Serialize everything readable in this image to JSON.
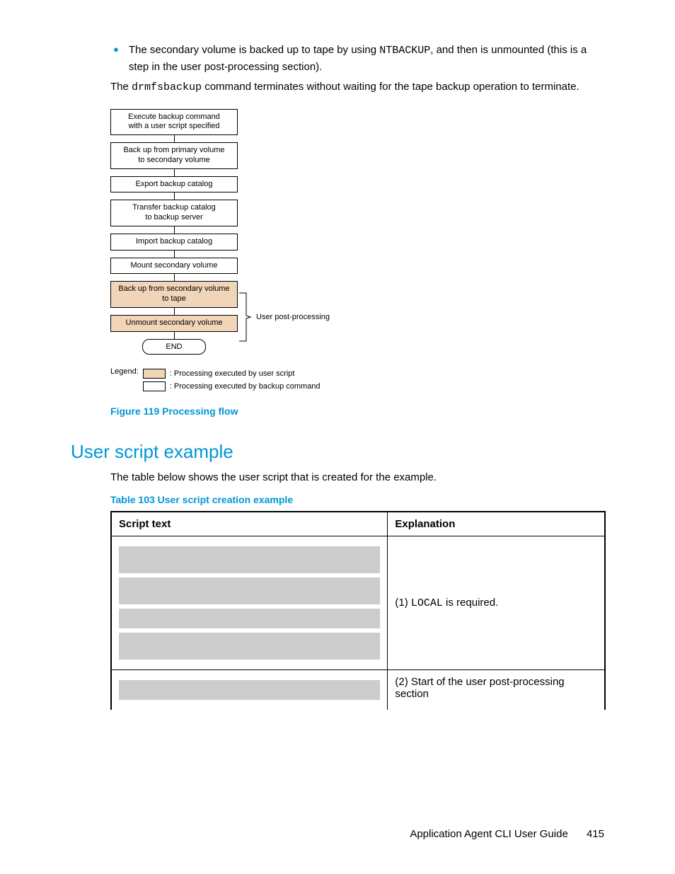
{
  "bullet": {
    "pre": "The secondary volume is backed up to tape by using ",
    "code": "NTBACKUP",
    "post": ", and then is unmounted (this is a step in the user post-processing section)."
  },
  "para": {
    "pre": "The ",
    "code": "drmfsbackup",
    "post": " command terminates without waiting for the tape backup operation to terminate."
  },
  "flow": {
    "b1": "Execute backup command\nwith a user script specified",
    "b2": "Back up from primary volume\nto secondary volume",
    "b3": "Export backup catalog",
    "b4": "Transfer backup catalog\nto backup server",
    "b5": "Import backup catalog",
    "b6": "Mount secondary volume",
    "b7": "Back up from secondary volume\nto tape",
    "b8": "Unmount secondary volume",
    "end": "END",
    "upp": "User post-processing"
  },
  "legend": {
    "title": "Legend:",
    "r1": ": Processing executed by user script",
    "r2": ": Processing executed by backup command"
  },
  "figcap": "Figure 119 Processing flow",
  "section": "User script example",
  "intro": "The table below shows the user script that is created for the example.",
  "tabcap": "Table 103 User script creation example",
  "th1": "Script text",
  "th2": "Explanation",
  "exp1_pre": "(1) ",
  "exp1_code": "LOCAL",
  "exp1_post": " is required.",
  "exp2": "(2) Start of the user post-processing section",
  "footer": "Application Agent CLI User Guide",
  "pagenum": "415"
}
